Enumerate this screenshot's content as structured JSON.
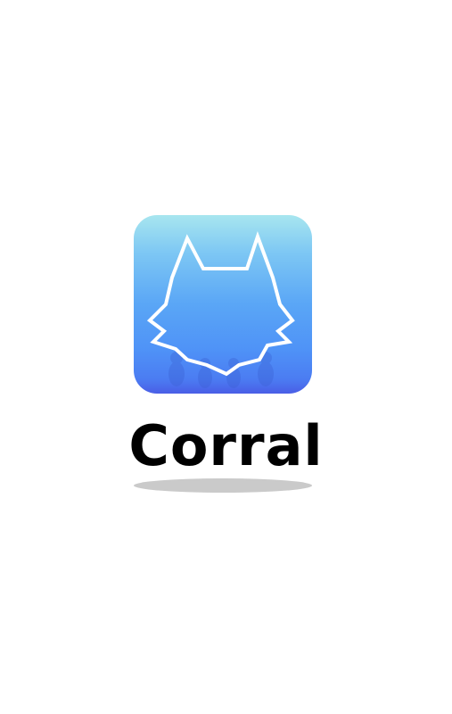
{
  "app": {
    "name": "Corral",
    "icon": "wolf-head-icon",
    "icon_gradient": [
      "#a8e6ef",
      "#5aa6f6",
      "#4a5ee6"
    ],
    "text_color": "#000000",
    "background": "#ffffff"
  }
}
